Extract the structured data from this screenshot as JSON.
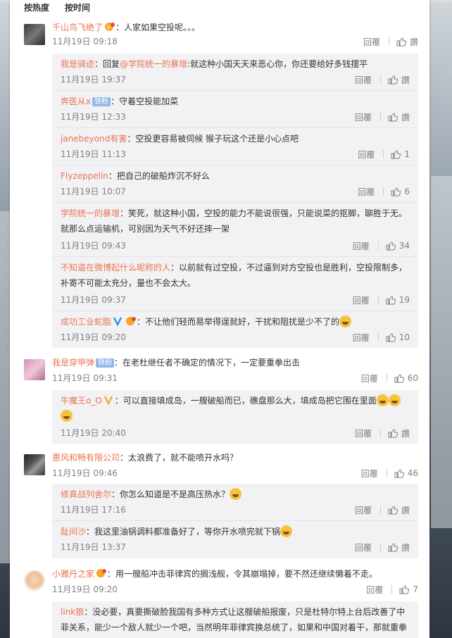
{
  "sort_tabs": [
    "按热度",
    "按时间"
  ],
  "reply_label": "回覆",
  "like_label": "讚",
  "colors": {
    "accent": "#eb7350",
    "badge": "#91b6e8",
    "reply_bg": "#f2f2f5"
  },
  "comments": [
    {
      "user": "千山鸟飞绝了",
      "vip": true,
      "text": "：人家如果空投呢。。。",
      "time": "11月19日 09:18",
      "likes": "讚",
      "replies": [
        {
          "user": "我是骑迹",
          "text_prefix": "：回复",
          "mention": "@学院统一的暴增",
          "text": ":就这种小国天天来恶心你，你还要给好多钱摆平",
          "time": "11月19日 19:37",
          "likes": "讚"
        },
        {
          "user": "奔医从x",
          "badge": "铁粉",
          "text": "：守着空投能加菜",
          "time": "11月19日 12:33",
          "likes": "讚"
        },
        {
          "user": "janebeyond有害",
          "text": "：空投更容易被伺候  猴子玩这个还是小心点吧",
          "time": "11月19日 11:13",
          "likes": "1"
        },
        {
          "user": "Flyzeppelin",
          "text": "：把自己的破船炸沉不好么",
          "time": "11月19日 10:07",
          "likes": "6"
        },
        {
          "user": "学院统一的暴增",
          "text": "：笑死，就这种小国，空投的能力不能说很强，只能说菜的抠脚，聊胜于无。",
          "text2": "就那么点运输机，可别因为天气不好还摔一架",
          "time": "11月19日 09:43",
          "likes": "34"
        },
        {
          "user": "不知道在微博起什么昵称的人",
          "text": "：以前就有过空投，不过逼到对方空投也是胜利，空投限制多，",
          "text2": "补寄不可能太充分，量也不会太大。",
          "time": "11月19日 09:37",
          "likes": "19"
        },
        {
          "user": "成功工业蛇脂",
          "vip": true,
          "text": "：不让他们轻而易举得逞就好，干扰和阻扰是少不了的",
          "emoji_count": 1,
          "time": "11月19日 09:20",
          "likes": "10"
        }
      ]
    },
    {
      "user": "我是穿甲弹",
      "badge": "铁粉",
      "text": "：在老杜继任者不确定的情况下，一定要重拳出击",
      "time": "11月19日 09:31",
      "likes": "60",
      "replies": [
        {
          "user": "牛魔王o_O",
          "text": "：可以直接填成岛，一艘破船而已，礁盘那么大，填成岛把它围在里面",
          "emoji_count": 2,
          "emoji_line2": 1,
          "time": "11月19日 20:40",
          "likes": "讚"
        }
      ]
    },
    {
      "user": "惠风和畅有限公司",
      "text": "：太浪费了，就不能喷开水吗？",
      "time": "11月19日 09:46",
      "likes": "46",
      "replies": [
        {
          "user": "修真战列舍尔",
          "text": "：你怎么知道是不是高压热水？",
          "emoji_count": 1,
          "time": "11月19日 17:16",
          "likes": "讚"
        },
        {
          "user": "趾间沙",
          "text": "：我这里油锅调料都准备好了，等你开水喷完就下锅",
          "emoji_count": 1,
          "time": "11月19日 13:37",
          "likes": "讚"
        }
      ]
    },
    {
      "user": "小雅丹之家",
      "vip": true,
      "text": "：用一艘船冲击菲律宾的搁浅舰，令其崩塌掉，要不然还继续懒着不走。",
      "time": "11月19日 09:20",
      "likes": "7",
      "replies": [
        {
          "user": "link狼",
          "text": "：没必要，真要撕破脸我国有多种方式让这艘破船报废，只是杜特尔特上台后改善了中",
          "text2": "菲关系，能少一个敌人就少一个吧，当然明年菲律宾换总统了，如果和中国对着干，那就重拳"
        }
      ]
    }
  ]
}
